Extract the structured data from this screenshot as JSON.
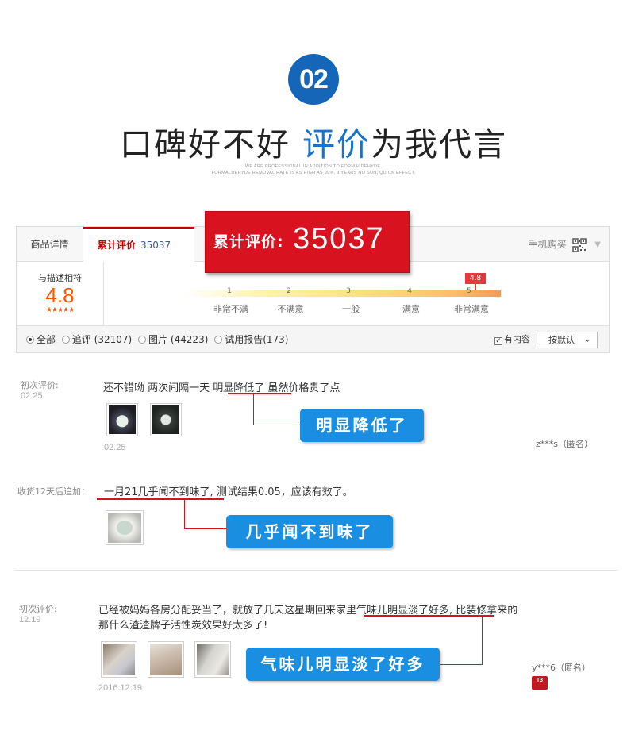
{
  "header": {
    "badge": "02",
    "title_black": "口碑好不好",
    "title_blue": "评价",
    "title_rest": "为我代言",
    "sub_line1": "WE ARE PROFESSIONAL IN ADDITION TO FORMALDEHYDE,",
    "sub_line2": "FORMALDEHYDE REMOVAL RATE IS AS HIGH AS 99%, 3 YEARS NO SUN, QUICK EFFECT."
  },
  "tabs": {
    "details": "商品详情",
    "reviews": "累计评价",
    "reviews_count": "35037",
    "mobile_buy": "手机购买"
  },
  "banner": {
    "label": "累计评价:",
    "count": "35037"
  },
  "rating": {
    "label": "与描述相符",
    "score": "4.8",
    "stars": "★★★★★",
    "stars_value": 5,
    "flag": "4.8",
    "scale_ticks": [
      "1",
      "2",
      "3",
      "4",
      "5"
    ],
    "scale_labels": [
      "非常不满",
      "不满意",
      "一般",
      "满意",
      "非常满意"
    ]
  },
  "filters": {
    "options": [
      "全部",
      "追评 (32107)",
      "图片 (44223)",
      "试用报告(173)"
    ],
    "selected": "全部",
    "has_content": "有内容",
    "sort": "按默认"
  },
  "reviews": [
    {
      "first_label": "初次评价:",
      "first_date": "02.25",
      "text_pre": "还不错呦  两次间隔一天  ",
      "text_hl": "明显降低了",
      "text_post": "  虽然价格贵了点",
      "photo_date": "02.25",
      "user": "z***s（匿名）",
      "callout": "明显降低了",
      "followup_label": "收货12天后追加：",
      "followup_hl": "一月21几乎闻不到味了,",
      "followup_post": "  测试结果0.05，应该有效了。",
      "followup_callout": "几乎闻不到味了"
    },
    {
      "first_label": "初次评价:",
      "first_date": "12.19",
      "line1_pre": "已经被妈妈各房分配妥当了，就放了几天这星期回来",
      "line1_hl": "家里气味儿明显淡了好多,",
      "line1_post": "  比装修拿来的",
      "line2": "那什么渣渣牌子活性炭效果好太多了!",
      "photo_date": "2016.12.19",
      "user": "y***6（匿名）",
      "avatar": "T3",
      "callout": "气味儿明显淡了好多"
    }
  ]
}
